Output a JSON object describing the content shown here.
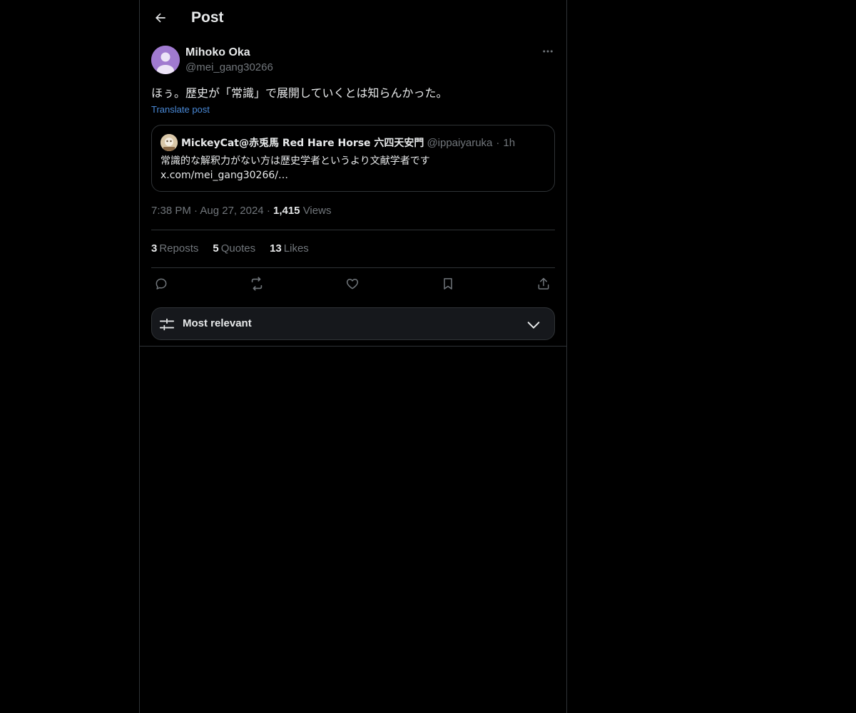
{
  "header": {
    "title": "Post"
  },
  "post": {
    "author_name": "Mihoko Oka",
    "author_handle": "@mei_gang30266",
    "text": "ほぅ。歴史が「常識」で展開していくとは知らんかった。",
    "translate_label": "Translate post",
    "time": "7:38 PM",
    "date": "Aug 27, 2024",
    "views_count": "1,415",
    "views_label": "Views"
  },
  "quote": {
    "name": "MickeyCat@赤兎馬 Red Hare Horse 六四天安門",
    "handle": "@ippaiyaruka",
    "time": "1h",
    "text_line1": "常識的な解釈力がない方は歴史学者というより文献学者です",
    "text_line2": "x.com/mei_gang30266/…"
  },
  "stats": {
    "reposts_count": "3",
    "reposts_label": "Reposts",
    "quotes_count": "5",
    "quotes_label": "Quotes",
    "likes_count": "13",
    "likes_label": "Likes"
  },
  "actions": [
    "reply-icon",
    "repost-icon",
    "like-icon",
    "bookmark-icon",
    "share-icon"
  ],
  "sort": {
    "label": "Most relevant"
  },
  "colors": {
    "background": "#000000",
    "text_primary": "#e7e9ea",
    "text_secondary": "#71767b",
    "link": "#4a8ad8",
    "border": "#2f3336",
    "avatar": "#a07ad0"
  }
}
